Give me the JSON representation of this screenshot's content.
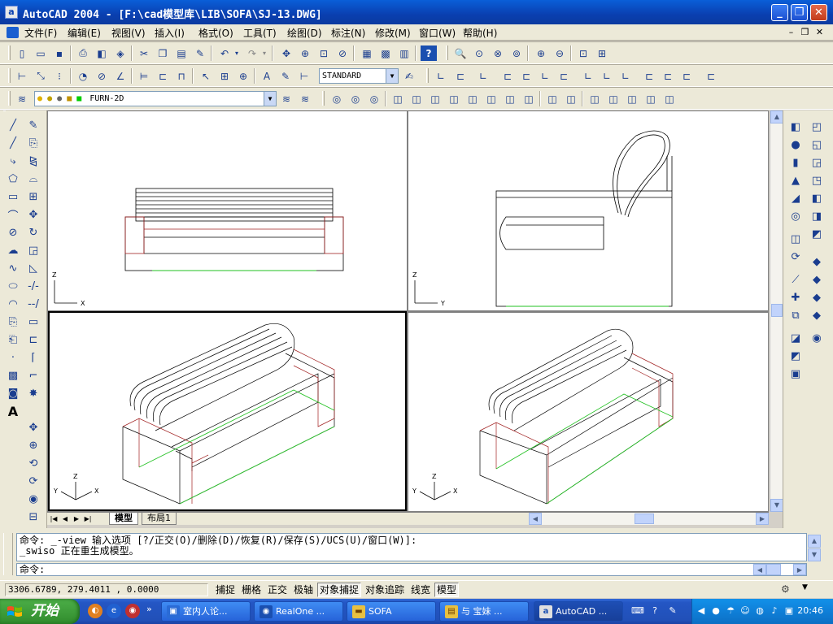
{
  "window": {
    "title": "AutoCAD 2004 - [F:\\cad模型库\\LIB\\SOFA\\SJ-13.DWG]",
    "app_icon_glyph": "a",
    "minimize_glyph": "_",
    "restore_glyph": "❐",
    "close_glyph": "✕"
  },
  "menu": {
    "items": [
      "文件(F)",
      "编辑(E)",
      "视图(V)",
      "插入(I)",
      "格式(O)",
      "工具(T)",
      "绘图(D)",
      "标注(N)",
      "修改(M)",
      "窗口(W)",
      "帮助(H)"
    ],
    "doc_min": "–",
    "doc_restore": "❐",
    "doc_close": "✕"
  },
  "toolbars": {
    "text_style": "STANDARD",
    "layer": "FURN-2D"
  },
  "viewports": {
    "top_left": {
      "axis_v": "Z",
      "axis_h": "X"
    },
    "top_right": {
      "axis_v": "Z",
      "axis_h": "Y"
    },
    "bottom_left": {
      "axis_v": "Z",
      "axis_h1": "Y",
      "axis_h2": "X"
    },
    "bottom_right": {
      "axis_v": "Z",
      "axis_h1": "Y",
      "axis_h2": "X"
    }
  },
  "layout_tabs": [
    {
      "label": "模型",
      "active": true
    },
    {
      "label": "布局1",
      "active": false
    }
  ],
  "command": {
    "history_line1": "命令: _-view 输入选项 [?/正交(O)/删除(D)/恢复(R)/保存(S)/UCS(U)/窗口(W)]:",
    "history_line2": "_swiso 正在重生成模型。",
    "prompt": "命令:"
  },
  "status": {
    "coords": "3306.6789, 279.4011 , 0.0000",
    "buttons": [
      {
        "label": "捕捉",
        "on": false
      },
      {
        "label": "栅格",
        "on": false
      },
      {
        "label": "正交",
        "on": false
      },
      {
        "label": "极轴",
        "on": false
      },
      {
        "label": "对象捕捉",
        "on": true
      },
      {
        "label": "对象追踪",
        "on": false
      },
      {
        "label": "线宽",
        "on": false
      },
      {
        "label": "模型",
        "on": true
      }
    ]
  },
  "taskbar": {
    "start_label": "开始",
    "tasks": [
      {
        "label": "室内人论...",
        "active": false
      },
      {
        "label": "RealOne ...",
        "active": false
      },
      {
        "label": "SOFA",
        "active": false
      },
      {
        "label": "与 宝妹 ...",
        "active": false
      },
      {
        "label": "AutoCAD ...",
        "active": true
      }
    ],
    "clock": "20:46"
  }
}
